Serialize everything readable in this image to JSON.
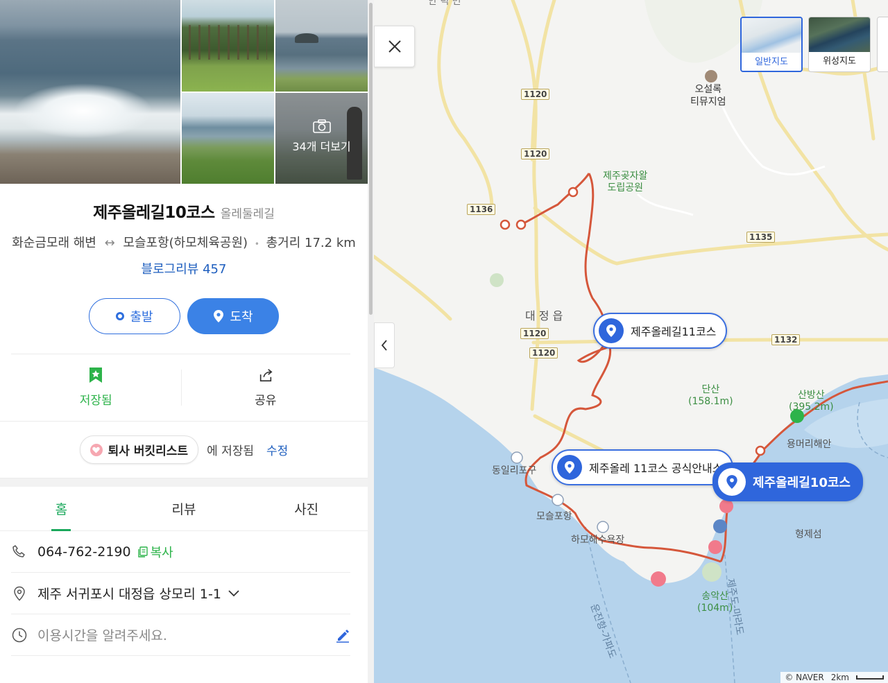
{
  "photos": {
    "more_label": "34개 더보기"
  },
  "place": {
    "name": "제주올레길10코스",
    "category": "올레둘레길",
    "start": "화순금모래 해변",
    "arrow": "↔",
    "end": "모슬포항(하모체육공원)",
    "distance": "총거리 17.2 km",
    "blog_review": "블로그리뷰 457"
  },
  "buttons": {
    "depart": "출발",
    "arrive": "도착"
  },
  "actions": {
    "saved": "저장됨",
    "share": "공유"
  },
  "bucket": {
    "chip_label": "퇴사 버킷리스트",
    "suffix": "에 저장됨",
    "edit": "수정"
  },
  "tabs": [
    "홈",
    "리뷰",
    "사진"
  ],
  "info": {
    "phone": "064-762-2190",
    "copy": "복사",
    "address": "제주 서귀포시 대정읍 상모리 1-1",
    "hours_placeholder": "이용시간을 알려주세요."
  },
  "map": {
    "type_normal": "일반지도",
    "type_satellite": "위성지도",
    "labels": {
      "osulloc": "오설록\n티뮤지엄",
      "forest": "제주곶자왈\n도립공원",
      "daejeong": "대 정 읍",
      "dansan": "단산\n(158.1m)",
      "sanbangsan": "산방산\n(395.2m)",
      "yongmeori": "용머리해안",
      "hyeongjeseom": "형제섬",
      "songaksan": "송악산\n(104m)",
      "dongilri": "동일리포구",
      "moseulpo": "모슬포항",
      "hamo": "하모해수욕장",
      "ferry1": "운진항-가파도",
      "ferry2": "제주도-마라도",
      "top_cut": "안 덕 면"
    },
    "roads": [
      "1120",
      "1120",
      "1136",
      "1135",
      "1120",
      "1120",
      "1132"
    ],
    "markers": {
      "course11": "제주올레길11코스",
      "info_center": "제주올레 11코스 공식안내소",
      "course10": "제주올레길10코스"
    },
    "attribution": "© NAVER",
    "scale": "2km"
  },
  "colors": {
    "accent": "#2f66dc",
    "saved": "#2db34a",
    "route": "#e0603f"
  }
}
